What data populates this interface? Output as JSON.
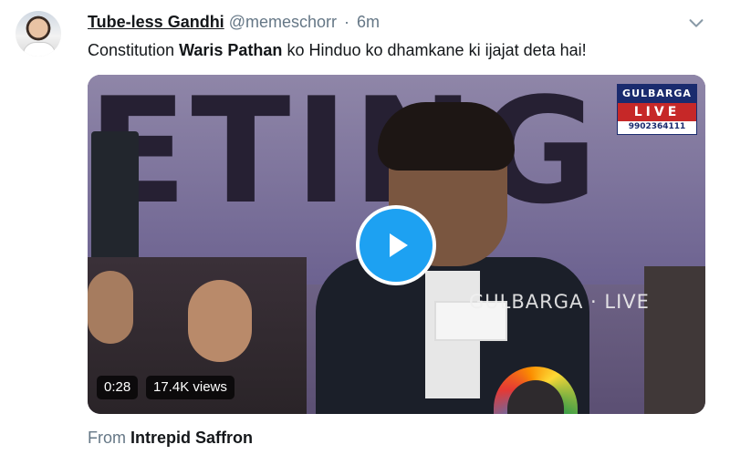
{
  "tweet": {
    "author_name": "Tube-less Gandhi",
    "handle": "@memeschorr",
    "separator": "·",
    "time": "6m",
    "text_prefix": "Constitution ",
    "text_bold": "Waris Pathan",
    "text_suffix": " ko Hinduo ko dhamkane ki ijajat deta hai!"
  },
  "video": {
    "duration": "0:28",
    "views": "17.4K views",
    "banner_text": "ETING",
    "logo_line1": "GULBARGA",
    "logo_line2": "LIVE",
    "logo_phone": "9902364111",
    "watermark": "GULBARGA · LIVE"
  },
  "footer": {
    "from_label": "From",
    "source": "Intrepid Saffron"
  },
  "icons": {
    "more": "chevron-down-icon",
    "play": "play-icon"
  },
  "colors": {
    "accent": "#1da1f2",
    "muted": "#657786",
    "text": "#14171a"
  }
}
